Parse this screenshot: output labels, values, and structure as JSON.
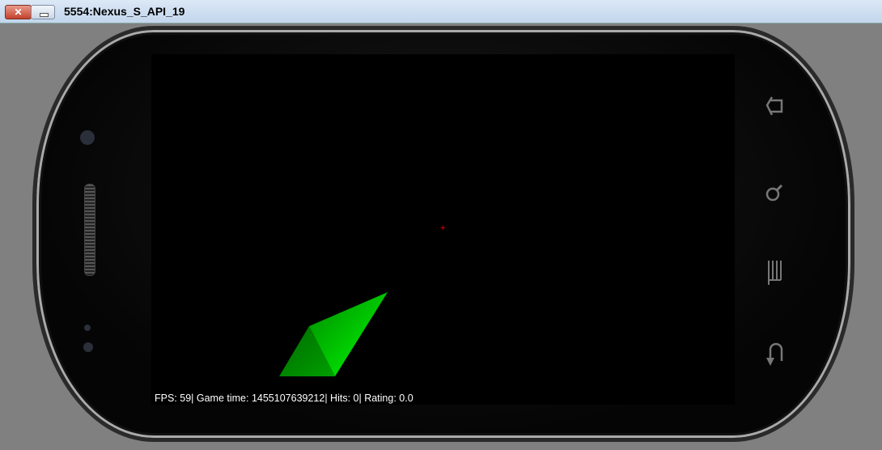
{
  "window": {
    "title": "5554:Nexus_S_API_19",
    "close_label": "✕"
  },
  "game": {
    "hud": "FPS: 59| Game time: 1455107639212| Hits: 0| Rating: 0.0",
    "crosshair": "+"
  },
  "nav_buttons": [
    "home-icon",
    "search-icon",
    "menu-icon",
    "back-icon"
  ],
  "colors": {
    "crosshair": "#ff0000",
    "shape": "#00cc00"
  }
}
